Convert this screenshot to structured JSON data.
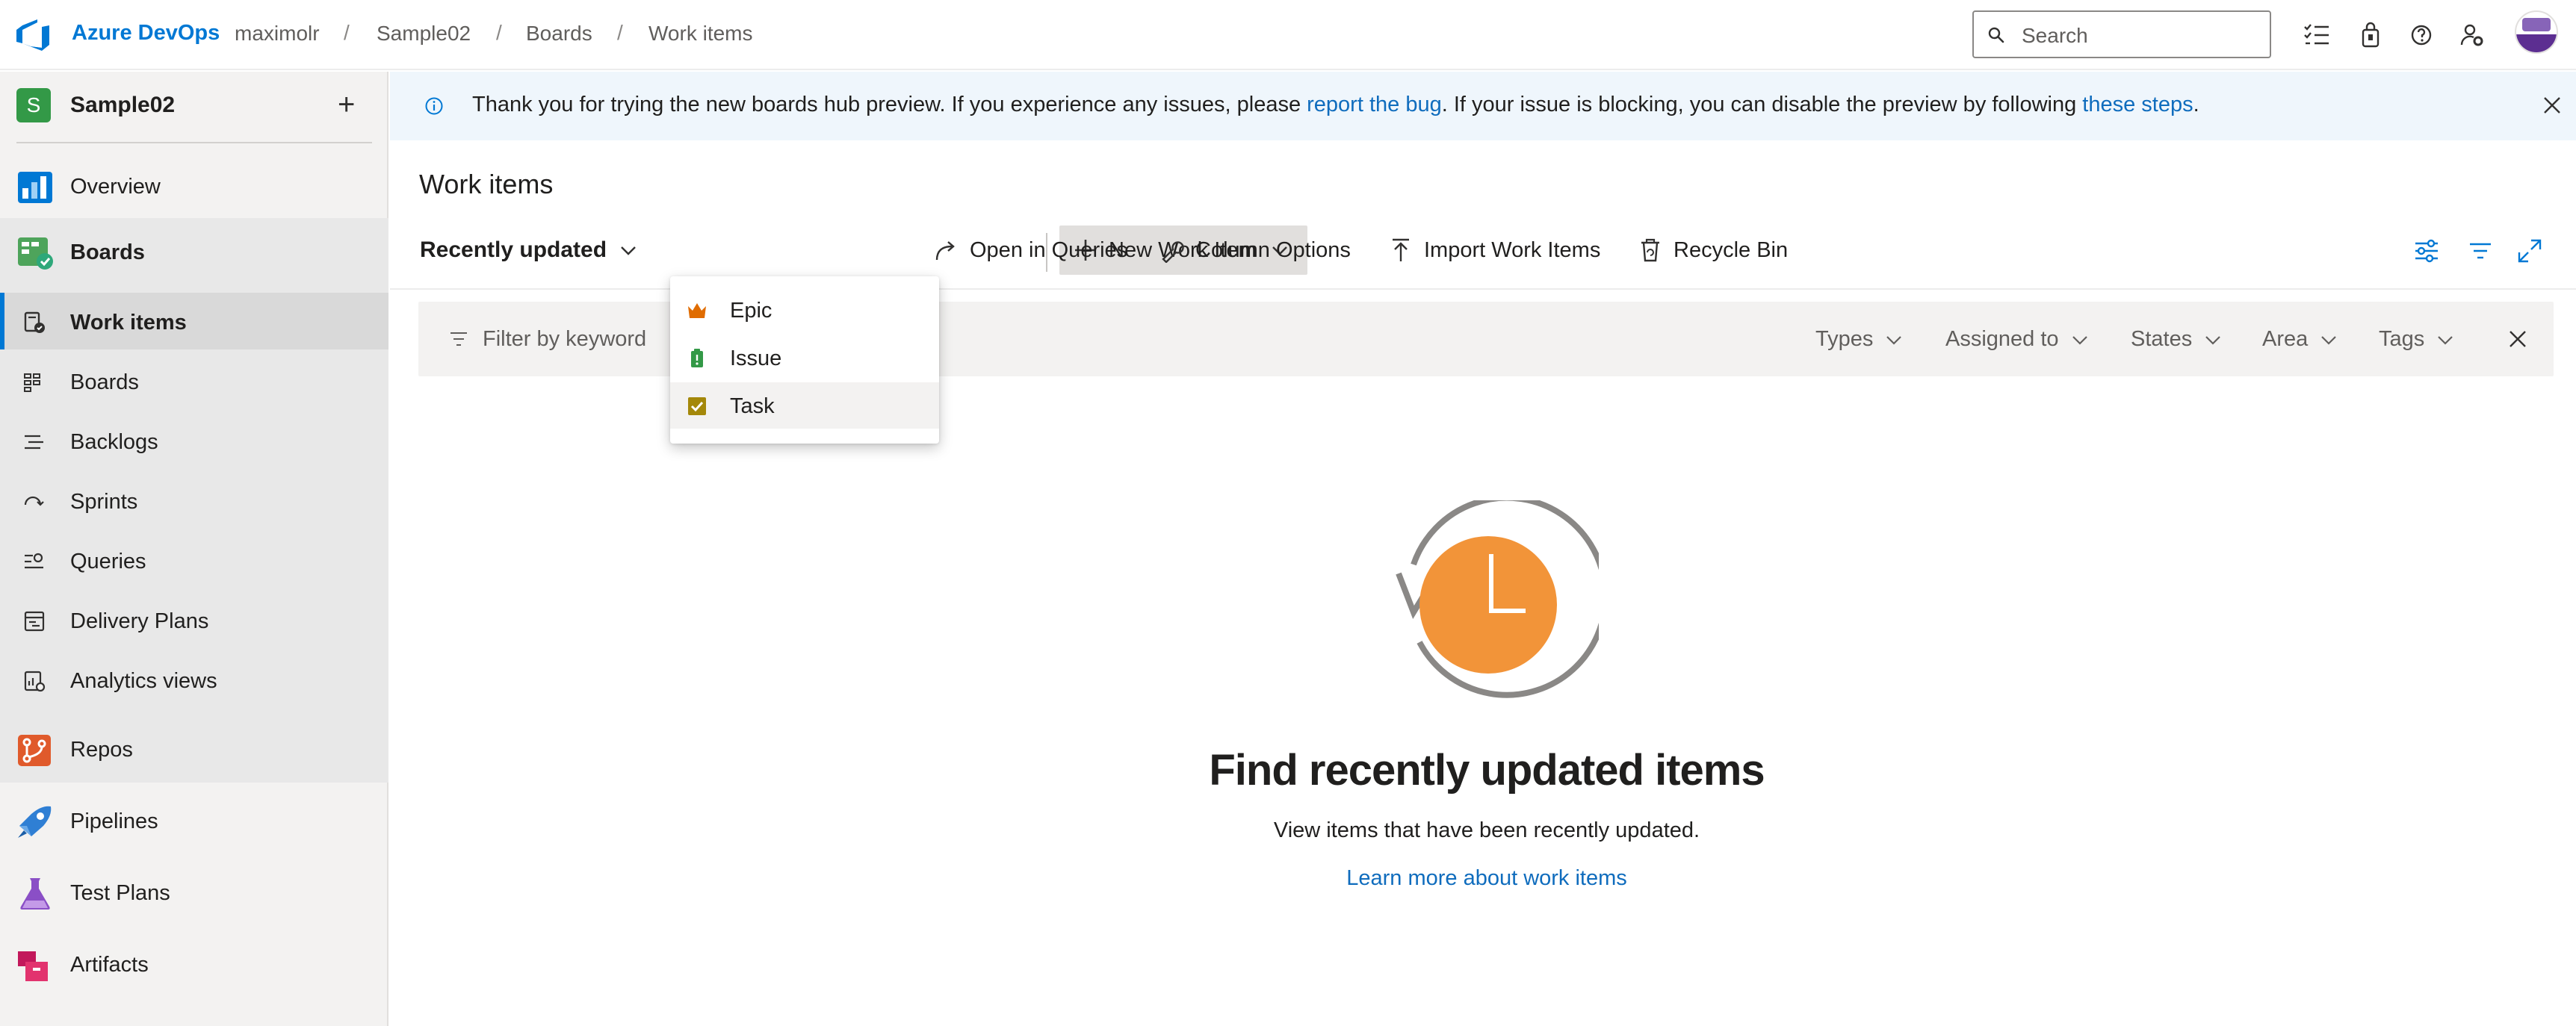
{
  "topbar": {
    "brand": "Azure DevOps",
    "breadcrumbs": [
      "maximolr",
      "Sample02",
      "Boards",
      "Work items"
    ],
    "separator": "/",
    "search_placeholder": "Search"
  },
  "sidebar": {
    "project_initial": "S",
    "project_name": "Sample02",
    "add_label": "+",
    "nav": [
      {
        "label": "Overview",
        "icon": "overview-icon"
      },
      {
        "label": "Boards",
        "icon": "boards-icon"
      },
      {
        "label": "Repos",
        "icon": "repos-icon"
      },
      {
        "label": "Pipelines",
        "icon": "pipelines-icon"
      },
      {
        "label": "Test Plans",
        "icon": "test-plans-icon"
      },
      {
        "label": "Artifacts",
        "icon": "artifacts-icon"
      }
    ],
    "boards_sub": [
      {
        "label": "Work items",
        "icon": "work-items-icon",
        "selected": true
      },
      {
        "label": "Boards",
        "icon": "kanban-icon"
      },
      {
        "label": "Backlogs",
        "icon": "backlogs-icon"
      },
      {
        "label": "Sprints",
        "icon": "sprints-icon"
      },
      {
        "label": "Queries",
        "icon": "queries-icon"
      },
      {
        "label": "Delivery Plans",
        "icon": "delivery-plans-icon"
      },
      {
        "label": "Analytics views",
        "icon": "analytics-icon"
      }
    ]
  },
  "banner": {
    "text_before": "Thank you for trying the new boards hub preview. If you experience any issues, please ",
    "link1": "report the bug",
    "text_middle": ". If your issue is blocking, you can disable the preview by following ",
    "link2": "these steps",
    "text_after": "."
  },
  "main": {
    "title": "Work items",
    "toolbar": {
      "view_label": "Recently updated",
      "new_work_item": "New Work Item",
      "open_in_queries": "Open in Queries",
      "column_options": "Column Options",
      "import_work_items": "Import Work Items",
      "recycle_bin": "Recycle Bin"
    },
    "filter": {
      "keyword_placeholder": "Filter by keyword",
      "dropdowns": [
        "Types",
        "Assigned to",
        "States",
        "Area",
        "Tags"
      ]
    },
    "new_item_menu": [
      {
        "label": "Epic",
        "icon": "epic-crown-icon",
        "color": "#e06c00"
      },
      {
        "label": "Issue",
        "icon": "issue-icon",
        "color": "#339947"
      },
      {
        "label": "Task",
        "icon": "task-icon",
        "color": "#a4880a"
      }
    ],
    "empty": {
      "title": "Find recently updated items",
      "subtitle": "View items that have been recently updated.",
      "link": "Learn more about work items"
    }
  },
  "colors": {
    "accent": "#0078d4",
    "link": "#0f6cbd",
    "clock_orange": "#f29439"
  }
}
